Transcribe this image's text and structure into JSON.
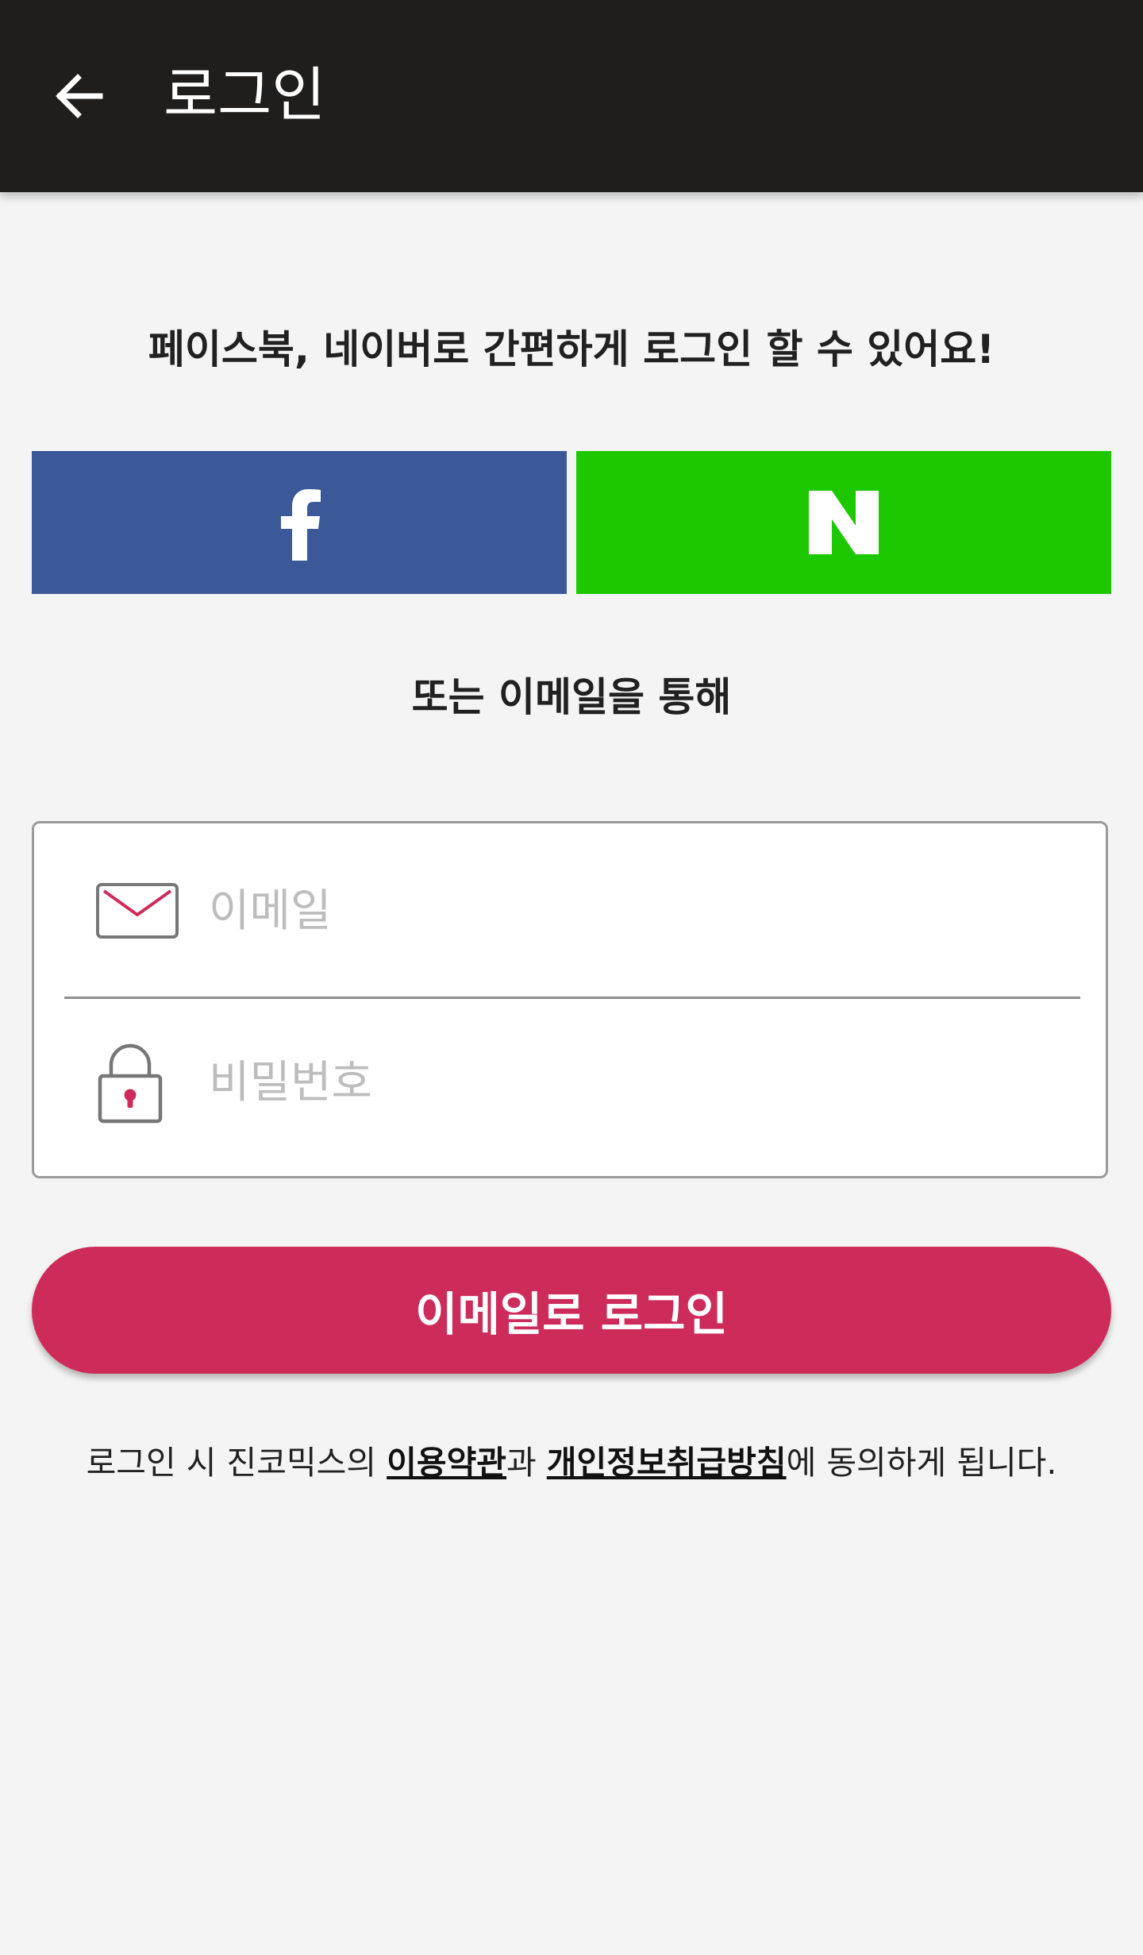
{
  "app_bar": {
    "title": "로그인",
    "back_icon": "arrow-left-icon",
    "background": "#1f1e1d"
  },
  "headline": "페이스북, 네이버로 간편하게 로그인 할 수 있어요!",
  "social": {
    "facebook": {
      "icon": "facebook-f-icon",
      "color": "#3b5998"
    },
    "naver": {
      "icon": "naver-n-icon",
      "color": "#1ec800"
    }
  },
  "divider_text": "또는 이메일을 통해",
  "form": {
    "email": {
      "placeholder": "이메일",
      "value": "",
      "icon": "envelope-icon"
    },
    "password": {
      "placeholder": "비밀번호",
      "value": "",
      "icon": "padlock-icon"
    }
  },
  "login_button": {
    "label": "이메일로 로그인",
    "color": "#cd2c5a"
  },
  "terms": {
    "prefix": "로그인 시 진코믹스의 ",
    "link1": "이용약관",
    "middle": "과 ",
    "link2": "개인정보취급방침",
    "suffix": "에 동의하게 됩니다."
  }
}
